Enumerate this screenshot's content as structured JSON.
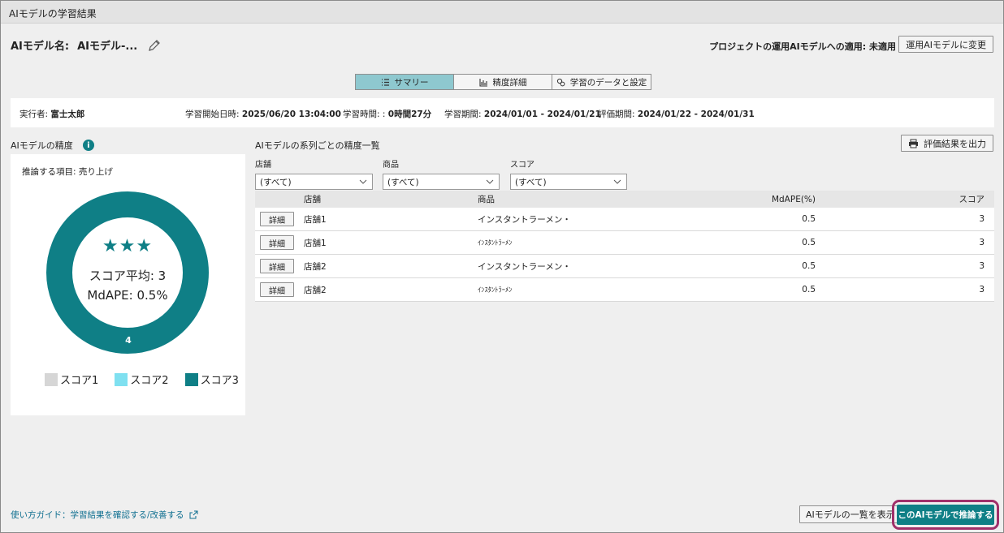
{
  "window": {
    "title": "AIモデルの学習結果"
  },
  "header": {
    "model_name_label": "AIモデル名:",
    "model_name_value": "AIモデル-...",
    "apply_status": "プロジェクトの運用AIモデルへの適用: 未適用",
    "change_button": "運用AIモデルに変更"
  },
  "tabs": [
    {
      "label": "サマリー",
      "icon": "list-icon",
      "active": true
    },
    {
      "label": "精度詳細",
      "icon": "bar-chart-icon",
      "active": false
    },
    {
      "label": "学習のデータと設定",
      "icon": "gears-icon",
      "active": false
    }
  ],
  "info": {
    "executor_label": "実行者:",
    "executor": "富士太郎",
    "start_label": "学習開始日時:",
    "start": "2025/06/20 13:04:00",
    "duration_label": "学習時間: :",
    "duration": "0時間27分",
    "period_label": "学習期間:",
    "period": "2024/01/01 - 2024/01/21",
    "eval_label": "評価期間:",
    "eval": "2024/01/22 - 2024/01/31"
  },
  "accuracy": {
    "title": "AIモデルの精度",
    "target": "推論する項目: 売り上げ",
    "stars": "★★★",
    "score_avg": "スコア平均: 3",
    "mdape": "MdAPE: 0.5%",
    "segments": [
      {
        "label": "スコア1",
        "count": 0,
        "color": "#d6d6d6"
      },
      {
        "label": "スコア2",
        "count": 0,
        "color": "#7fe0f0"
      },
      {
        "label": "スコア3",
        "count": 4,
        "color": "#0f7f86"
      }
    ],
    "segment_count_label": "4"
  },
  "series_list": {
    "title": "AIモデルの系列ごとの精度一覧",
    "export_button": "評価結果を出力",
    "filters": [
      {
        "label": "店舗",
        "value": "(すべて)"
      },
      {
        "label": "商品",
        "value": "(すべて)"
      },
      {
        "label": "スコア",
        "value": "(すべて)"
      }
    ],
    "columns": [
      "店舗",
      "商品",
      "MdAPE(%)",
      "スコア"
    ],
    "detail_label": "詳細",
    "rows": [
      {
        "store": "店舗1",
        "item": "インスタントラーメン・",
        "small": false,
        "mdape": "0.5",
        "score": "3"
      },
      {
        "store": "店舗1",
        "item": "ｲﾝｽﾀﾝﾄﾗｰﾒﾝ",
        "small": true,
        "mdape": "0.5",
        "score": "3"
      },
      {
        "store": "店舗2",
        "item": "インスタントラーメン・",
        "small": false,
        "mdape": "0.5",
        "score": "3"
      },
      {
        "store": "店舗2",
        "item": "ｲﾝｽﾀﾝﾄﾗｰﾒﾝ",
        "small": true,
        "mdape": "0.5",
        "score": "3"
      }
    ]
  },
  "footer": {
    "guide_link": "使い方ガイド：学習結果を確認する/改善する",
    "list_button": "AIモデルの一覧を表示",
    "infer_button": "このAIモデルで推論する"
  },
  "colors": {
    "accent": "#0f7f86",
    "tab_active": "#8ec8cf",
    "highlight": "#a0306a",
    "link": "#0f6f90"
  }
}
